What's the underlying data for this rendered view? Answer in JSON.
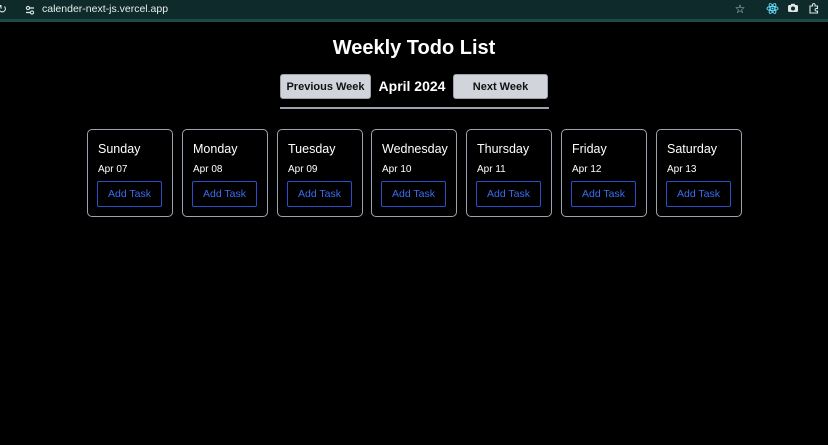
{
  "browser": {
    "url": "calender-next-js.vercel.app",
    "icons": [
      "reload-icon",
      "site-info-icon",
      "star-icon",
      "react-devtools-icon",
      "camera-icon",
      "extensions-icon"
    ]
  },
  "page": {
    "title": "Weekly Todo List",
    "prev_label": "Previous Week",
    "next_label": "Next Week",
    "month": "April 2024"
  },
  "days": [
    {
      "name": "Sunday",
      "date": "Apr 07",
      "button": "Add Task"
    },
    {
      "name": "Monday",
      "date": "Apr 08",
      "button": "Add Task"
    },
    {
      "name": "Tuesday",
      "date": "Apr 09",
      "button": "Add Task"
    },
    {
      "name": "Wednesday",
      "date": "Apr 10",
      "button": "Add Task"
    },
    {
      "name": "Thursday",
      "date": "Apr 11",
      "button": "Add Task"
    },
    {
      "name": "Friday",
      "date": "Apr 12",
      "button": "Add Task"
    },
    {
      "name": "Saturday",
      "date": "Apr 13",
      "button": "Add Task"
    }
  ],
  "colors": {
    "background": "#000000",
    "accent": "#3b6cf0",
    "browser_bar": "#0e2a2a"
  }
}
